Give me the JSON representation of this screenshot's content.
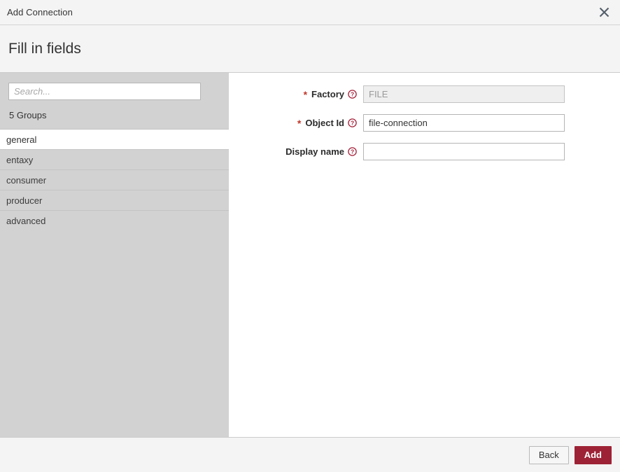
{
  "titlebar": {
    "title": "Add Connection",
    "close_icon": "close-icon"
  },
  "wizard": {
    "heading": "Fill in fields"
  },
  "sidebar": {
    "search": {
      "placeholder": "Search...",
      "value": ""
    },
    "groups_count_label": "5 Groups",
    "items": [
      {
        "label": "general",
        "selected": true
      },
      {
        "label": "entaxy",
        "selected": false
      },
      {
        "label": "consumer",
        "selected": false
      },
      {
        "label": "producer",
        "selected": false
      },
      {
        "label": "advanced",
        "selected": false
      }
    ]
  },
  "form": {
    "fields": [
      {
        "label": "Factory",
        "required": true,
        "required_marker": "*",
        "help_icon": "help-circle-icon",
        "value": "FILE",
        "placeholder": "",
        "disabled": true
      },
      {
        "label": "Object Id",
        "required": true,
        "required_marker": "*",
        "help_icon": "help-circle-icon",
        "value": "file-connection",
        "placeholder": "",
        "disabled": false
      },
      {
        "label": "Display name",
        "required": false,
        "required_marker": "",
        "help_icon": "help-circle-icon",
        "value": "",
        "placeholder": "",
        "disabled": false
      }
    ]
  },
  "footer": {
    "back_label": "Back",
    "add_label": "Add"
  },
  "colors": {
    "accent": "#9d2235",
    "required_star": "#c0392b",
    "sidebar_bg": "#d2d2d2",
    "header_bg": "#f4f4f4",
    "border": "#cccccc"
  }
}
